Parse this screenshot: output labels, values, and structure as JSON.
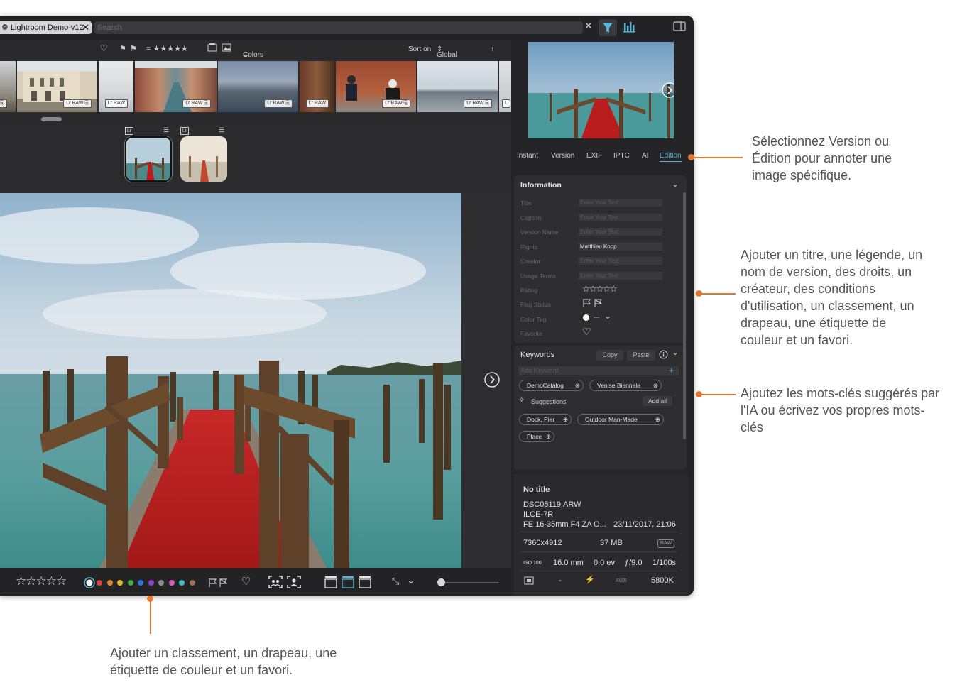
{
  "window": {
    "tab_label": "Lightroom Demo-v12",
    "search_placeholder": "Search",
    "close_glyph": "✕"
  },
  "filmstrip_toolbar": {
    "rating_filter": "= ★★★★★",
    "colors_label": "Colors",
    "sort_label": "Sort on",
    "sort_value": "Global Score",
    "sort_direction_glyph": "↑"
  },
  "filmstrip": {
    "badges": [
      "RAW",
      "RAW",
      "RAW",
      "RAW",
      "RAW",
      "RAW",
      "RAW",
      "RAW"
    ],
    "badge_prefix": "Lr"
  },
  "versions": {
    "lr_label": "Lr"
  },
  "bottom_toolbar": {
    "stars": "☆☆☆☆☆",
    "color_dots": [
      "#e04040",
      "#e08a30",
      "#e0c030",
      "#40b040",
      "#3070e0",
      "#9040d0",
      "#909090",
      "#d060c0",
      "#40c0c0",
      "#a07050"
    ]
  },
  "right_panel": {
    "tabs": [
      "Instant",
      "Version",
      "EXIF",
      "IPTC",
      "AI",
      "Edition"
    ],
    "active_tab": "Edition",
    "information": {
      "title": "Information",
      "fields": [
        {
          "label": "Title",
          "value": "Enter Your Text"
        },
        {
          "label": "Caption",
          "value": "Enter Your Text"
        },
        {
          "label": "Version Name",
          "value": "Enter Your Text"
        },
        {
          "label": "Rights",
          "value": "Matthieu Kopp"
        },
        {
          "label": "Creator",
          "value": "Enter Your Text"
        },
        {
          "label": "Usage Terms",
          "value": "Enter Your Text"
        }
      ],
      "rating_label": "Rating",
      "rating_value": "☆☆☆☆☆",
      "flag_label": "Flag Status",
      "color_tag_label": "Color Tag",
      "color_tag_value": "...",
      "favorite_label": "Favorite"
    },
    "keywords": {
      "title": "Keywords",
      "copy_label": "Copy",
      "paste_label": "Paste",
      "add_placeholder": "Add Keyword",
      "add_plus": "+",
      "chips": [
        "DemoCatalog",
        "Venise Biennale"
      ],
      "suggestions_label": "Suggestions",
      "add_all_label": "Add all",
      "suggested": [
        "Dock, Pier",
        "Outdoor Man-Made",
        "Place"
      ]
    },
    "meta": {
      "title": "No title",
      "filename": "DSC05119.ARW",
      "camera": "ILCE-7R",
      "lens": "FE 16-35mm F4 ZA O...",
      "date": "23/11/2017, 21:06",
      "dimensions": "7360x4912",
      "size": "37 MB",
      "format": "RAW",
      "iso_label": "ISO 100",
      "focal": "16.0 mm",
      "ev": "0.0 ev",
      "aperture": "ƒ/9.0",
      "shutter": "1/100s",
      "dash": "-",
      "awb": "AWB",
      "kelvin": "5800K"
    }
  },
  "annotations": {
    "a1": [
      "Sélectionnez Version ou",
      "Édition pour annoter une",
      "image spécifique."
    ],
    "a2": [
      "Ajouter un titre, une légende, un",
      "nom de version, des droits, un",
      "créateur, des conditions",
      "d'utilisation, un classement, un",
      "drapeau, une étiquette de",
      "couleur et un favori."
    ],
    "a3": [
      "Ajoutez les mots-clés suggérés par",
      "l'IA ou écrivez vos propres mots-",
      "clés"
    ],
    "a4": [
      "Ajouter un classement, un drapeau, une",
      "étiquette de couleur et un favori."
    ]
  },
  "colors": {
    "accent": "#5ab4d6",
    "annotation": "#e2762f"
  }
}
